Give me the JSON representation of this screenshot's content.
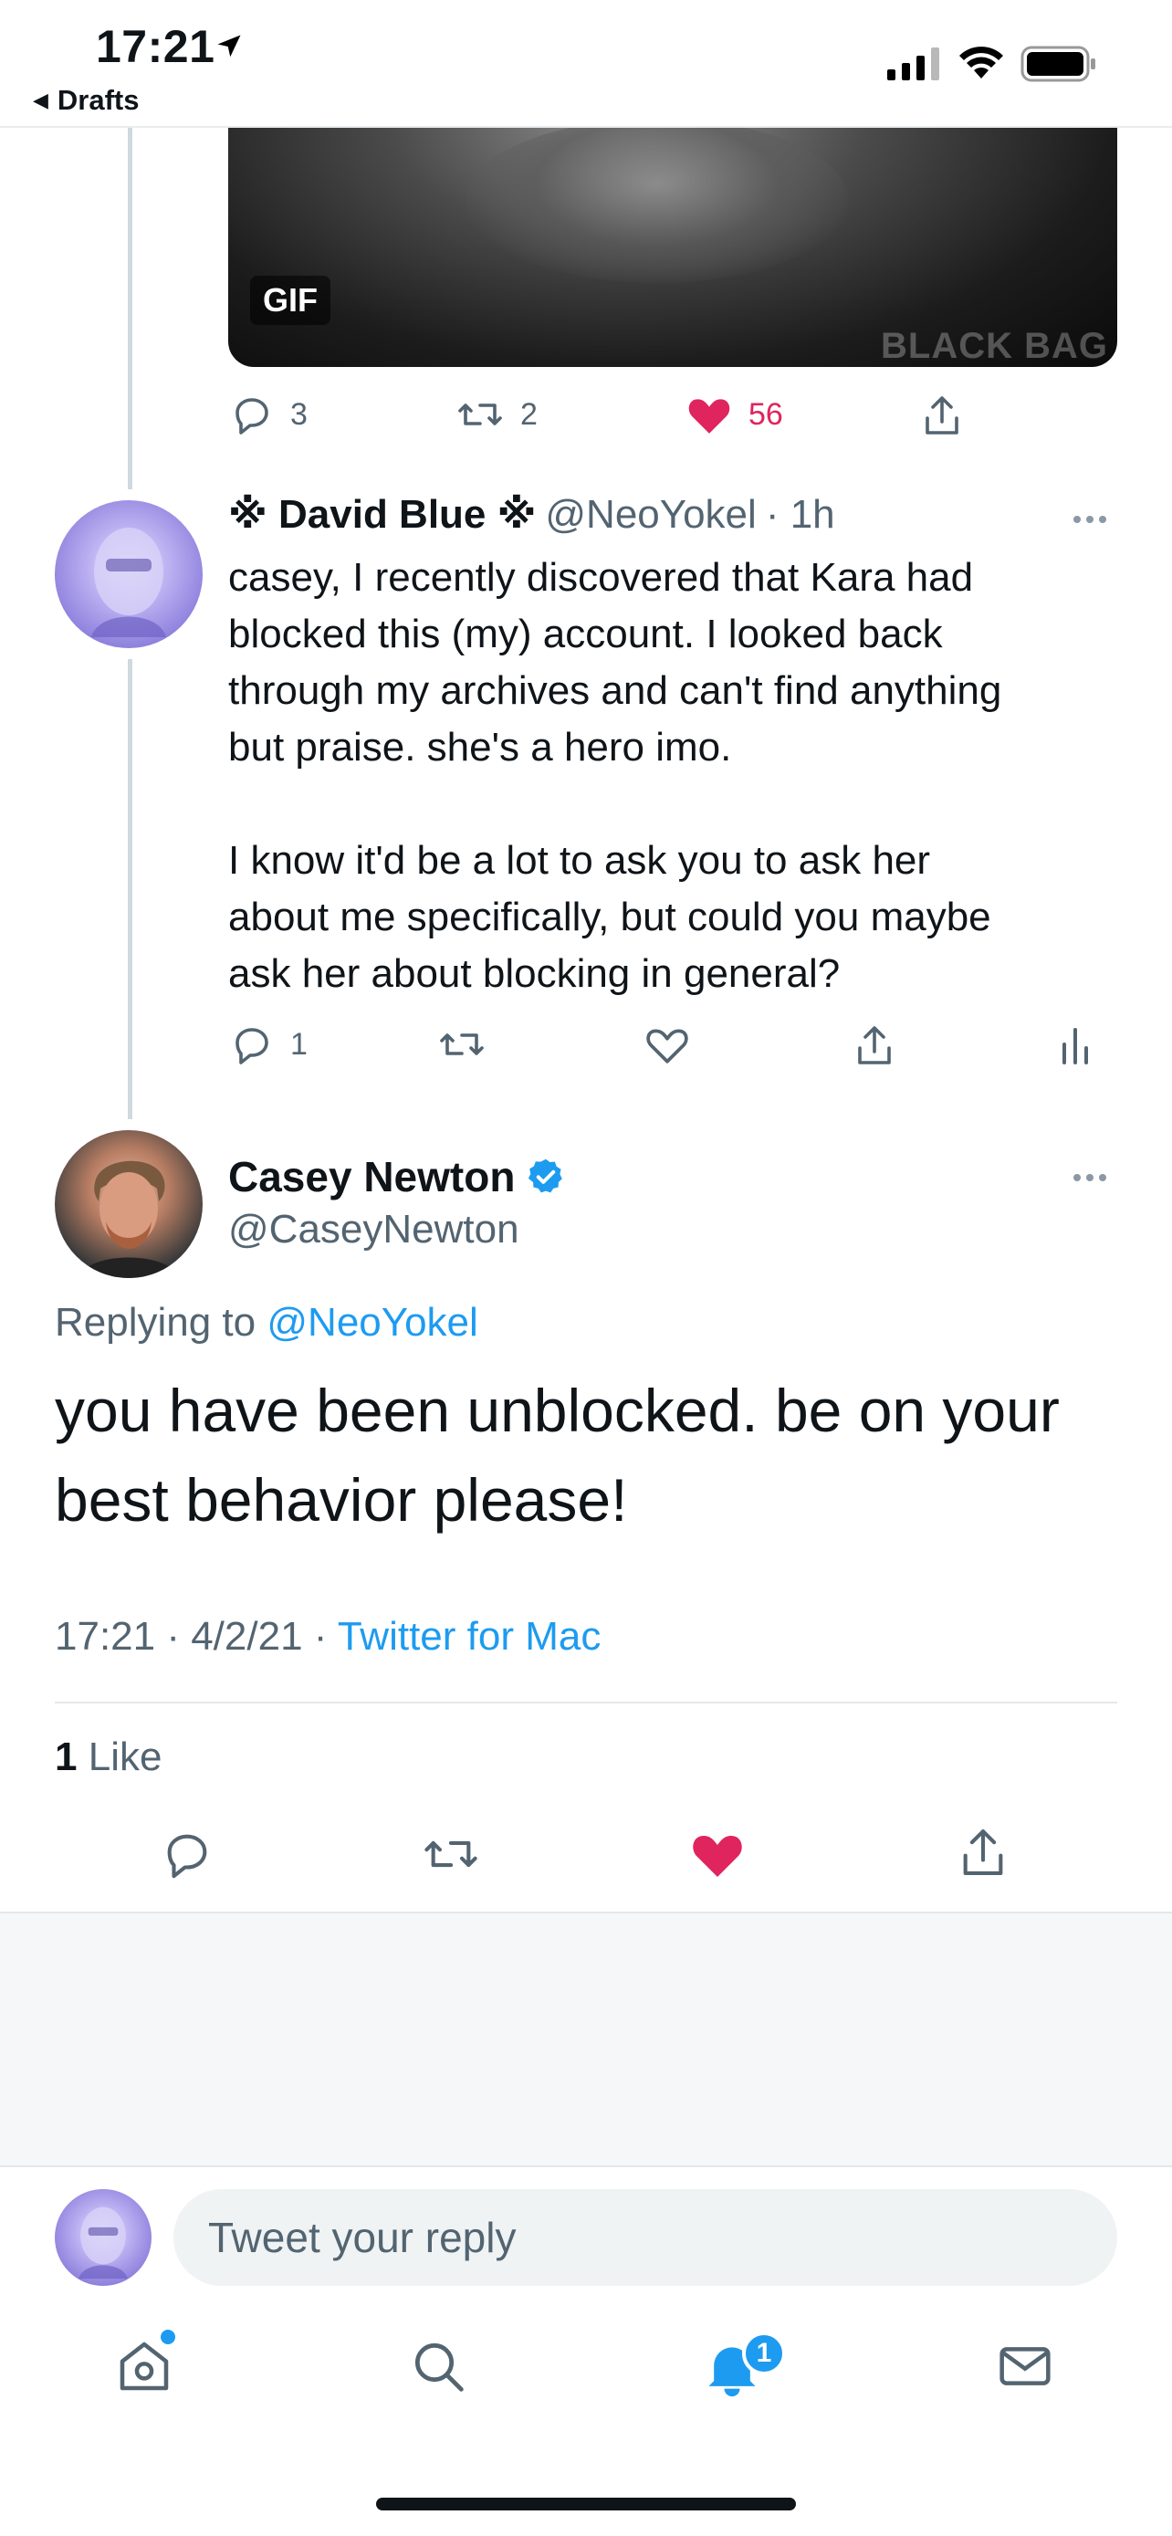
{
  "status_bar": {
    "time": "17:21",
    "back_label": "Drafts"
  },
  "gif": {
    "badge": "GIF",
    "watermark": "BLACK BAG"
  },
  "prev_tweet_actions": {
    "replies": "3",
    "retweets": "2",
    "likes": "56"
  },
  "reply_tweet": {
    "display_name": "※ David Blue ※",
    "handle": "@NeoYokel",
    "time": "· 1h",
    "text": "casey, I recently discovered that Kara had\nblocked this (my) account. I looked back\nthrough my archives and can't find anything\nbut praise. she's a hero imo.\n\nI know it'd be a lot to ask you to ask her\nabout me specifically, but could you maybe\nask her about blocking in general?",
    "replies": "1"
  },
  "main_tweet": {
    "display_name": "Casey Newton",
    "handle": "@CaseyNewton",
    "replying_prefix": "Replying to",
    "replying_to": "@NeoYokel",
    "text": "you have been unblocked. be on your best behavior please!",
    "timestamp": "17:21 · 4/2/21 ·",
    "source": "Twitter for Mac",
    "like_count": "1",
    "like_label": "Like"
  },
  "composer": {
    "placeholder": "Tweet your reply"
  },
  "tabbar": {
    "notifications_badge": "1"
  },
  "colors": {
    "accent": "#1d9bf0",
    "like": "#e0245e",
    "muted": "#536471"
  },
  "icons": [
    "location-arrow-icon",
    "signal-icon",
    "wifi-icon",
    "battery-icon",
    "reply-icon",
    "retweet-icon",
    "heart-icon",
    "share-icon",
    "analytics-icon",
    "more-icon",
    "verified-icon",
    "home-icon",
    "search-icon",
    "bell-icon",
    "mail-icon"
  ]
}
